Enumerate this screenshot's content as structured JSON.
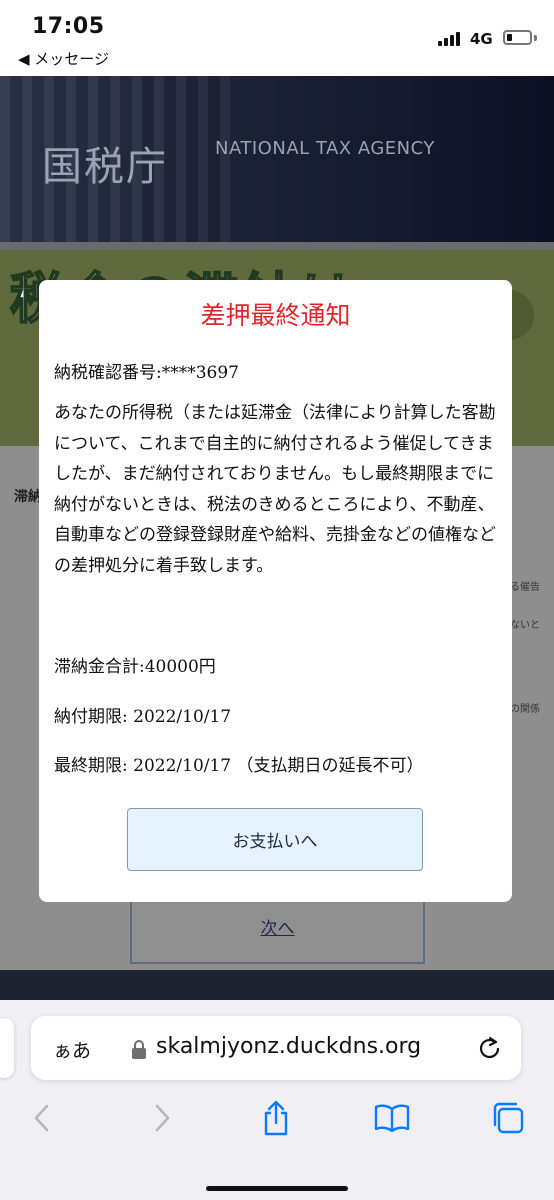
{
  "status_bar": {
    "time": "17:05",
    "back_label": "◀ メッセージ",
    "network": "4G",
    "signal_icon": "signal-bars-icon",
    "battery_icon": "battery-low-icon"
  },
  "site": {
    "logo": "国税庁",
    "logo_en": "NATIONAL TAX AGENCY",
    "banner_text": "税金の滞納は",
    "tab_label": "滞納",
    "side_text_1": "る催告",
    "side_text_2": "ないと",
    "side_text_3": "の関係",
    "next_label": "次へ"
  },
  "modal": {
    "title": "差押最終通知",
    "reference": "納税確認番号:****3697",
    "body": "あなたの所得税（または延滞金（法律により計算した客勘 について、これまで自主的に納付されるよう催促してきま したが、まだ納付されておりません。もし最終期限までに 納付がないときは、税法のきめるところにより、不動産、自動車などの登録登録財産や給料、売掛金などの値権など の差押処分に着手致します。",
    "total": "滞納金合計:40000円",
    "due": "納付期限: 2022/10/17",
    "final": "最終期限: 2022/10/17 （支払期日の延長不可）",
    "pay_button": "お支払いへ"
  },
  "browser": {
    "aa_label": "ぁあ",
    "url": "skalmjyonz.duckdns.org",
    "icons": [
      "lock-icon",
      "reload-icon",
      "back-arrow-icon",
      "forward-arrow-icon",
      "share-icon",
      "bookmarks-icon",
      "tabs-icon"
    ]
  },
  "colors": {
    "title_red": "#e0262b",
    "button_bg": "#e5f2fb",
    "chrome_bg": "#f0eff4",
    "ios_blue": "#0a7aff"
  }
}
